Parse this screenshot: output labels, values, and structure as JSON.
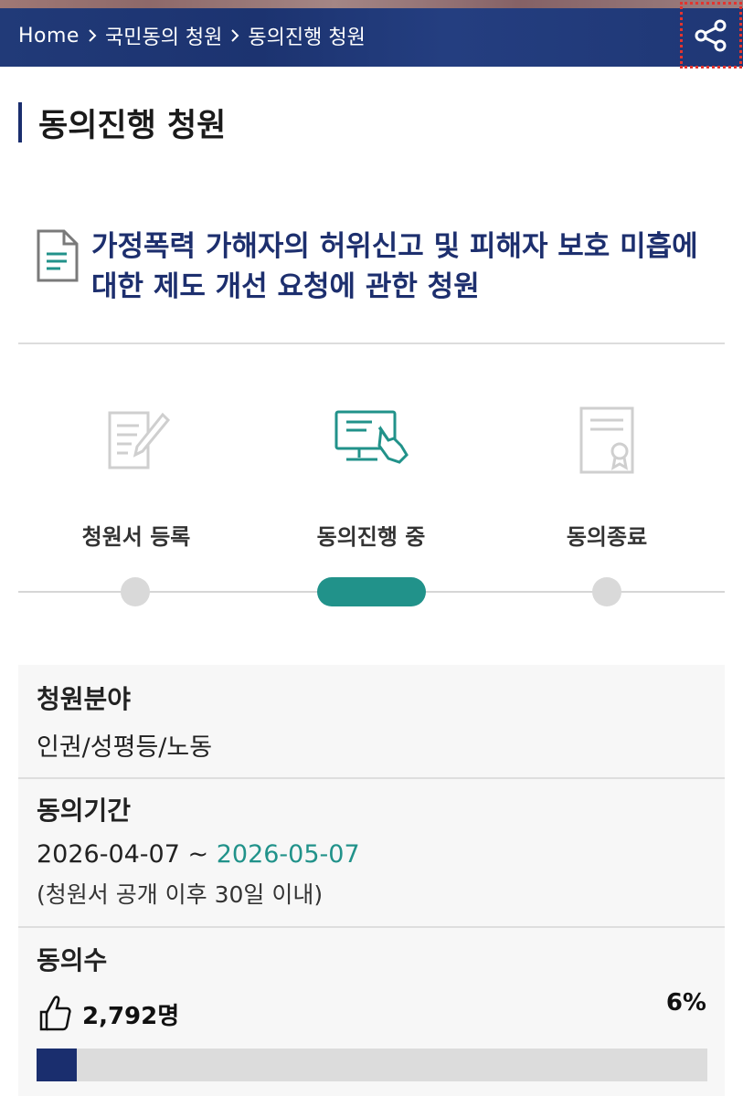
{
  "breadcrumb": {
    "home": "Home",
    "level1": "국민동의 청원",
    "level2": "동의진행 청원"
  },
  "page_title": "동의진행 청원",
  "petition": {
    "title": "가정폭력 가해자의 허위신고 및 피해자 보호 미흡에 대한 제도 개선 요청에 관한 청원"
  },
  "steps": [
    {
      "label": "청원서 등록",
      "icon": "petition-register-icon",
      "status": "done"
    },
    {
      "label": "동의진행 중",
      "icon": "consent-in-progress-icon",
      "status": "current"
    },
    {
      "label": "동의종료",
      "icon": "consent-closed-icon",
      "status": "pending"
    }
  ],
  "info": {
    "field_heading": "청원분야",
    "field_value": "인권/성평등/노동",
    "period_heading": "동의기간",
    "period_start": "2026-04-07",
    "period_sep": " ~ ",
    "period_end": "2026-05-07",
    "period_note": "(청원서 공개 이후 30일 이내)",
    "count_heading": "동의수",
    "count_value": "2,792명",
    "percent_label": "6%",
    "progress_fraction": 0.06
  },
  "colors": {
    "navy": "#1a2e6e",
    "teal": "#21928a",
    "gray_dot": "#d9d9d9"
  },
  "icons": {
    "share": "share-icon",
    "chevron": "chevron-right-icon",
    "document": "document-icon",
    "thumb": "thumbs-up-icon"
  }
}
